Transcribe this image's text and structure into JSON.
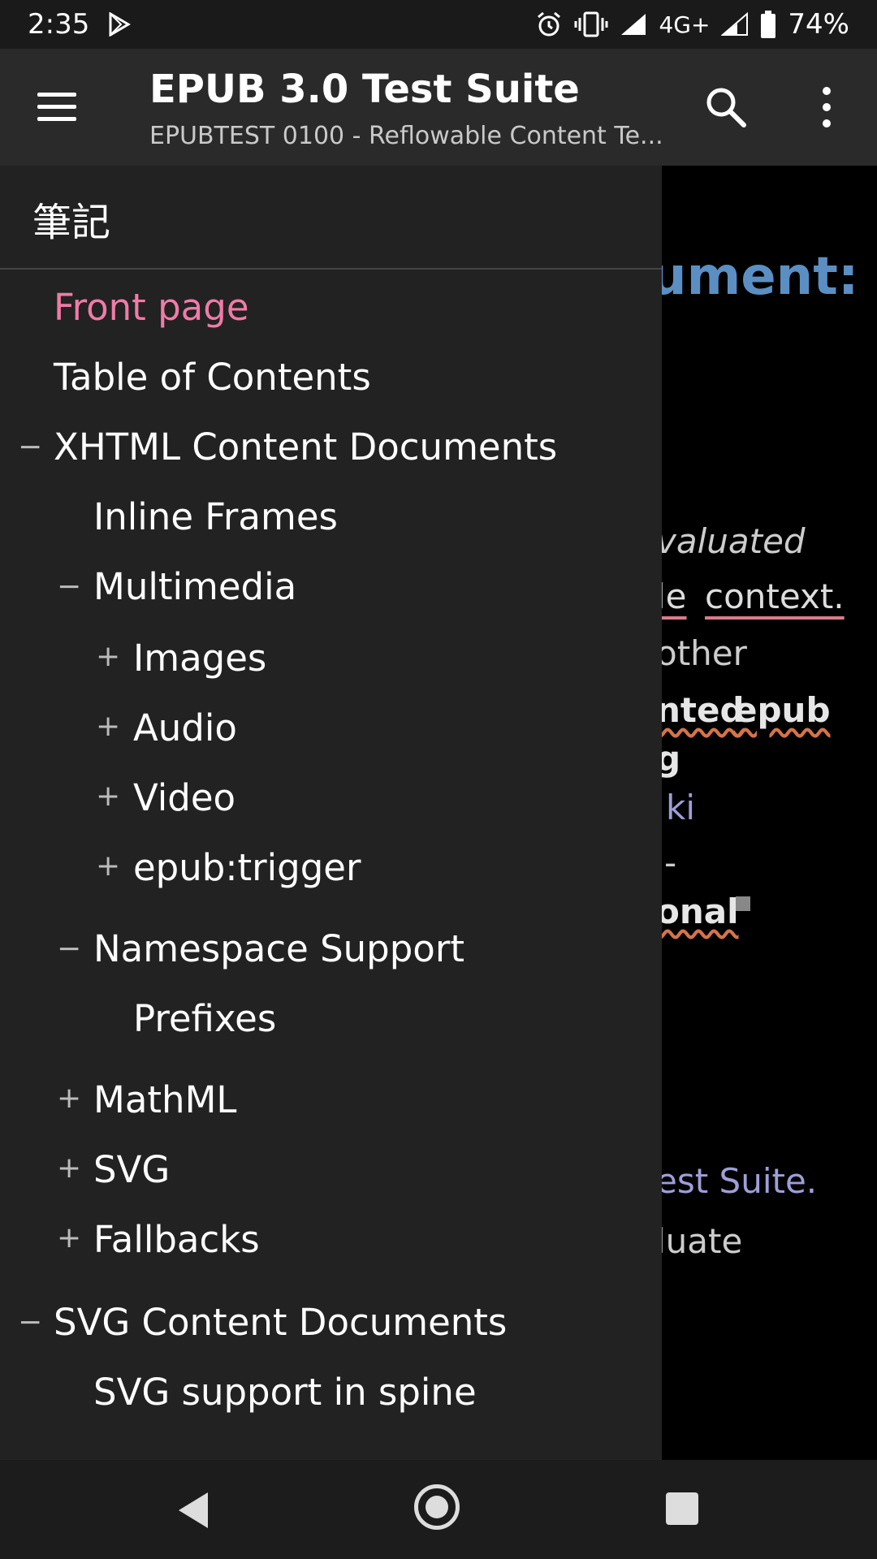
{
  "status": {
    "time": "2:35",
    "network": "4G+",
    "battery": "74%"
  },
  "app_bar": {
    "title": "EPUB 3.0 Test Suite",
    "subtitle": "EPUBTEST 0100 - Reflowable Content Te..."
  },
  "background_text": [
    "ument:",
    "valuated",
    "le",
    "context.",
    "other",
    "nted",
    "epub",
    "g",
    "ki",
    "-",
    "onal",
    "est Suite.",
    "luate"
  ],
  "drawer": {
    "header": "筆記",
    "items": [
      {
        "label": "Front page",
        "toggle": ""
      },
      {
        "label": "Table of Contents",
        "toggle": ""
      },
      {
        "label": "XHTML Content Documents",
        "toggle": "−"
      },
      {
        "label": "Inline Frames",
        "toggle": ""
      },
      {
        "label": "Multimedia",
        "toggle": "−"
      },
      {
        "label": "Images",
        "toggle": "+"
      },
      {
        "label": "Audio",
        "toggle": "+"
      },
      {
        "label": "Video",
        "toggle": "+"
      },
      {
        "label": "epub:trigger",
        "toggle": "+"
      },
      {
        "label": "Namespace Support",
        "toggle": "−"
      },
      {
        "label": "Prefixes",
        "toggle": ""
      },
      {
        "label": "MathML",
        "toggle": "+"
      },
      {
        "label": "SVG",
        "toggle": "+"
      },
      {
        "label": "Fallbacks",
        "toggle": "+"
      },
      {
        "label": "SVG Content Documents",
        "toggle": "−"
      },
      {
        "label": "SVG support in spine",
        "toggle": ""
      }
    ]
  },
  "icons": {
    "play_store": "play-store-icon",
    "alarm": "alarm-icon",
    "vibrate": "vibrate-icon",
    "signal": "signal-icon",
    "battery": "battery-icon",
    "hamburger": "hamburger-menu-icon",
    "search": "search-icon",
    "more": "more-vertical-icon",
    "back": "nav-back-icon",
    "home": "nav-home-icon",
    "recent": "nav-recent-icon"
  }
}
